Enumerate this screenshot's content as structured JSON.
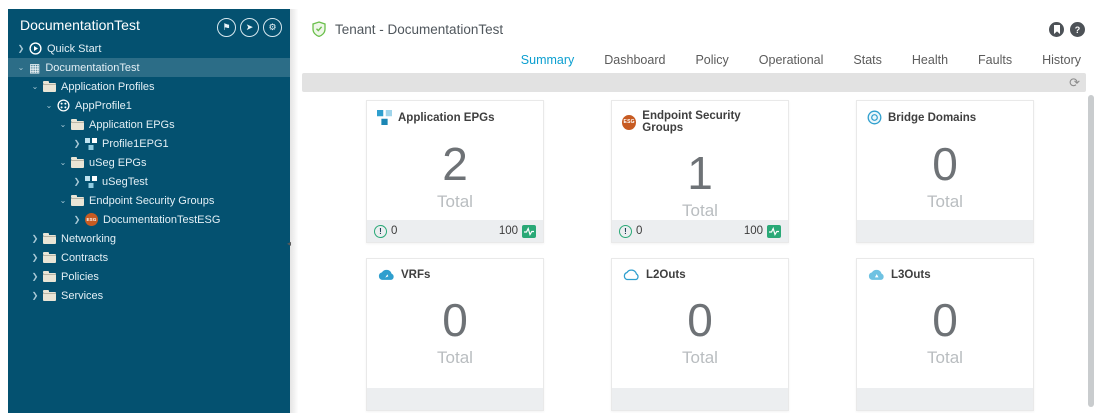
{
  "sidebar": {
    "title": "DocumentationTest",
    "header_icons": [
      {
        "name": "flag-icon",
        "glyph": "⚑"
      },
      {
        "name": "pin-icon",
        "glyph": "➤"
      },
      {
        "name": "settings-icon",
        "glyph": "⚙"
      }
    ],
    "tree": [
      {
        "label": "Quick Start"
      },
      {
        "label": "DocumentationTest"
      },
      {
        "label": "Application Profiles"
      },
      {
        "label": "AppProfile1"
      },
      {
        "label": "Application EPGs"
      },
      {
        "label": "Profile1EPG1"
      },
      {
        "label": "uSeg EPGs"
      },
      {
        "label": "uSegTest"
      },
      {
        "label": "Endpoint Security Groups"
      },
      {
        "label": "DocumentationTestESG"
      },
      {
        "label": "Networking"
      },
      {
        "label": "Contracts"
      },
      {
        "label": "Policies"
      },
      {
        "label": "Services"
      }
    ]
  },
  "header": {
    "title": "Tenant - DocumentationTest",
    "tabs": [
      {
        "label": "Summary",
        "active": true
      },
      {
        "label": "Dashboard",
        "active": false
      },
      {
        "label": "Policy",
        "active": false
      },
      {
        "label": "Operational",
        "active": false
      },
      {
        "label": "Stats",
        "active": false
      },
      {
        "label": "Health",
        "active": false
      },
      {
        "label": "Faults",
        "active": false
      },
      {
        "label": "History",
        "active": false
      }
    ]
  },
  "cards": [
    {
      "title": "Application EPGs",
      "value": "2",
      "total_label": "Total",
      "faults": "0",
      "health": "100"
    },
    {
      "title": "Endpoint Security Groups",
      "value": "1",
      "total_label": "Total",
      "faults": "0",
      "health": "100"
    },
    {
      "title": "Bridge Domains",
      "value": "0",
      "total_label": "Total"
    },
    {
      "title": "VRFs",
      "value": "0",
      "total_label": "Total"
    },
    {
      "title": "L2Outs",
      "value": "0",
      "total_label": "Total"
    },
    {
      "title": "L3Outs",
      "value": "0",
      "total_label": "Total"
    }
  ],
  "colors": {
    "sidebar_bg": "#045170",
    "accent_blue": "#0c9fd0",
    "health_green": "#2aa977",
    "esg_orange": "#c75b22"
  }
}
